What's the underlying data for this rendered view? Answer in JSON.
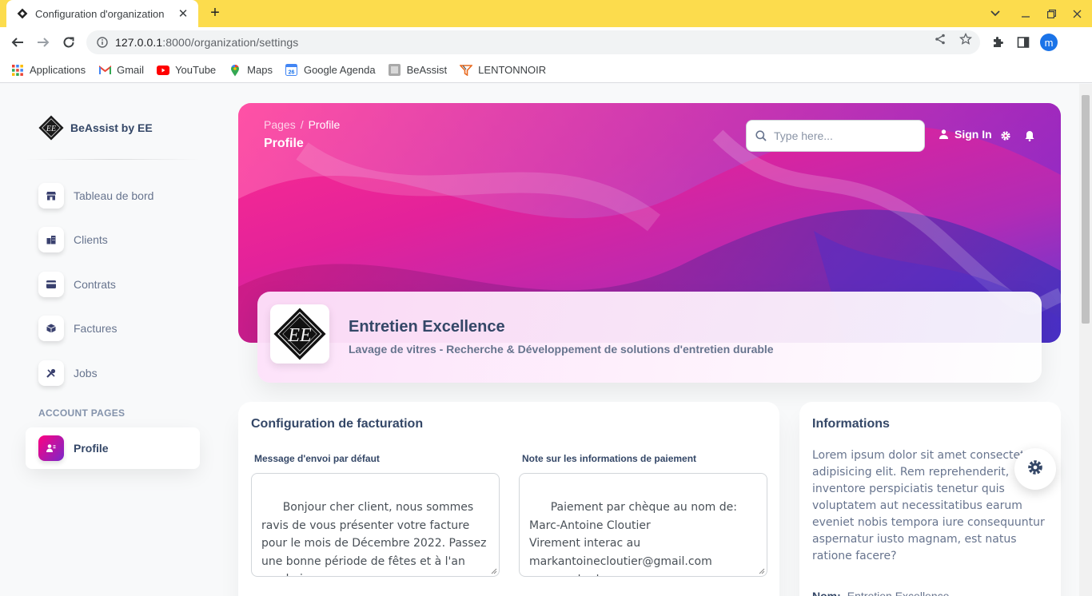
{
  "browser": {
    "tab_title": "Configuration d'organization",
    "url_host": "127.0.0.1",
    "url_rest": ":8000/organization/settings",
    "avatar_initial": "m",
    "bookmarks": [
      {
        "label": "Applications",
        "icon": "apps-grid-icon"
      },
      {
        "label": "Gmail",
        "icon": "gmail-icon"
      },
      {
        "label": "YouTube",
        "icon": "youtube-icon"
      },
      {
        "label": "Maps",
        "icon": "maps-pin-icon"
      },
      {
        "label": "Google Agenda",
        "icon": "calendar-icon"
      },
      {
        "label": "BeAssist",
        "icon": "beassist-icon"
      },
      {
        "label": "LENTONNOIR",
        "icon": "funnel-icon"
      }
    ]
  },
  "sidebar": {
    "brand": "BeAssist by EE",
    "items": [
      {
        "label": "Tableau de bord",
        "icon": "shop-icon"
      },
      {
        "label": "Clients",
        "icon": "office-icon"
      },
      {
        "label": "Contrats",
        "icon": "credit-card-icon"
      },
      {
        "label": "Factures",
        "icon": "box-icon"
      },
      {
        "label": "Jobs",
        "icon": "tools-icon"
      }
    ],
    "section_label": "ACCOUNT PAGES",
    "active_item": {
      "label": "Profile",
      "icon": "profile-icon"
    }
  },
  "header": {
    "breadcrumb_root": "Pages",
    "breadcrumb_sep": "/",
    "breadcrumb_current": "Profile",
    "page_title": "Profile",
    "search_placeholder": "Type here...",
    "sign_in": "Sign In"
  },
  "profile": {
    "name": "Entretien Excellence",
    "description": "Lavage de vitres - Recherche & Développement de solutions d'entretien durable"
  },
  "billing": {
    "title": "Configuration de facturation",
    "message_label": "Message d'envoi par défaut",
    "message_value": "Bonjour cher client, nous sommes ravis de vous présenter votre facture pour le mois de Décembre 2022. Passez une bonne période de fêtes et à l'an prochain.",
    "payment_label": "Note sur les informations de paiement",
    "payment_value": "Paiement par chèque au nom de:\nMarc-Antoine Cloutier\nVirement interac au\nmarkantoinecloutier@gmail.com\nou comptant"
  },
  "info": {
    "title": "Informations",
    "text": "Lorem ipsum dolor sit amet consectetur adipisicing elit. Rem reprehenderit, inventore perspiciatis tenetur quis voluptatem aut necessitatibus earum eveniet nobis tempora iure consequuntur aspernatur iusto magnam, est natus ratione facere?",
    "name_key": "Nom:",
    "name_value": "Entretien Excellence"
  }
}
